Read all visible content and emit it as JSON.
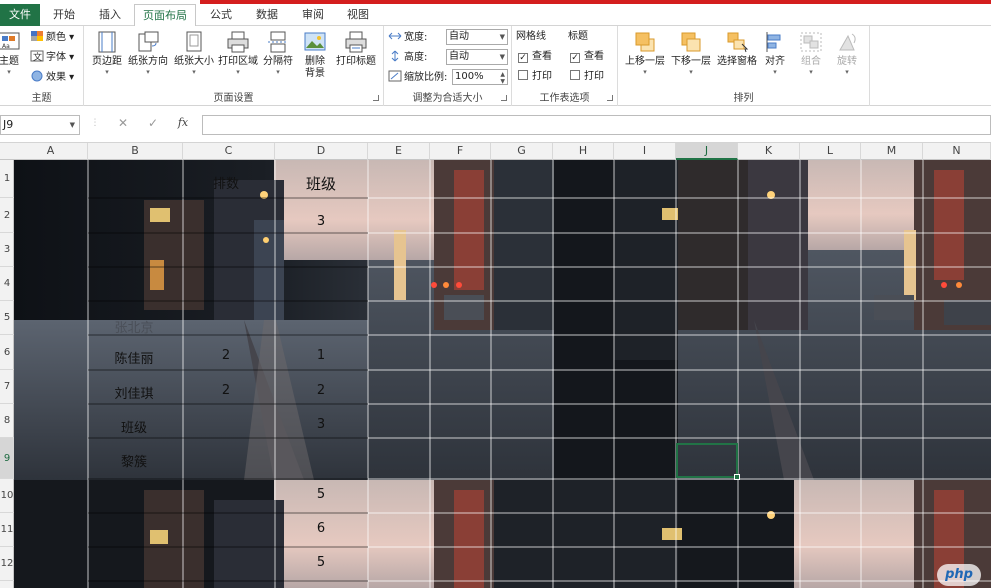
{
  "tabs": [
    {
      "label": "文件",
      "kind": "file"
    },
    {
      "label": "开始",
      "kind": "normal"
    },
    {
      "label": "插入",
      "kind": "normal"
    },
    {
      "label": "页面布局",
      "kind": "active"
    },
    {
      "label": "公式",
      "kind": "normal"
    },
    {
      "label": "数据",
      "kind": "normal"
    },
    {
      "label": "审阅",
      "kind": "normal"
    },
    {
      "label": "视图",
      "kind": "normal"
    }
  ],
  "ribbon": {
    "theme": {
      "main_label": "主题",
      "colors_label": "颜色",
      "fonts_label": "字体",
      "effects_label": "效果",
      "group_label": "主题"
    },
    "page_setup": {
      "margins_label": "页边距",
      "orientation_label": "纸张方向",
      "size_label": "纸张大小",
      "print_area_label": "打印区域",
      "breaks_label": "分隔符",
      "delete_bg_label": "删除背景",
      "print_titles_label": "打印标题",
      "group_label": "页面设置"
    },
    "scale": {
      "width_label": "宽度:",
      "width_value": "自动",
      "height_label": "高度:",
      "height_value": "自动",
      "scale_label": "缩放比例:",
      "scale_value": "100%",
      "group_label": "调整为合适大小"
    },
    "sheet_options": {
      "gridlines_label": "网格线",
      "headings_label": "标题",
      "view_label": "查看",
      "print_label": "打印",
      "gridlines_view": true,
      "gridlines_print": false,
      "headings_view": true,
      "headings_print": false,
      "group_label": "工作表选项"
    },
    "arrange": {
      "bring_forward_label": "上移一层",
      "send_backward_label": "下移一层",
      "selection_pane_label": "选择窗格",
      "align_label": "对齐",
      "group_obj_label": "组合",
      "rotate_label": "旋转",
      "group_label": "排列"
    }
  },
  "formula_bar": {
    "name_box": "J9",
    "cancel_icon": "✕",
    "enter_icon": "✓",
    "fx_label": "fx",
    "formula": ""
  },
  "sheet": {
    "columns": [
      "A",
      "B",
      "C",
      "D",
      "E",
      "F",
      "G",
      "H",
      "I",
      "J",
      "K",
      "L",
      "M",
      "N"
    ],
    "selected_column": "J",
    "rows": [
      "1",
      "2",
      "3",
      "4",
      "5",
      "6",
      "7",
      "8",
      "9",
      "10",
      "11",
      "12"
    ],
    "selected_row": "9",
    "cells": {
      "C1": "排数",
      "D1": "班级",
      "D2": "3",
      "B5": "张北京",
      "B6": "陈佳丽",
      "C6": "2",
      "D6": "1",
      "B7": "刘佳琪",
      "C7": "2",
      "D7": "2",
      "B8": "班级",
      "D8": "3",
      "B9": "黎簇",
      "D10": "5",
      "D11": "6",
      "D12": "5"
    }
  },
  "watermark": "php",
  "colors": {
    "excel_green": "#217346",
    "accent_red": "#d41e1e"
  }
}
